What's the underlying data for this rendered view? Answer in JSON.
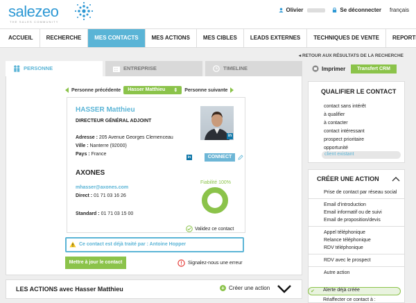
{
  "header": {
    "logo": "salezeo",
    "tagline": "THE SALES COMMUNITY",
    "user_name": "Olivier",
    "logout": "Se déconnecter",
    "language": "français"
  },
  "nav": {
    "items": [
      "ACCUEIL",
      "RECHERCHE",
      "MES CONTACTS",
      "MES ACTIONS",
      "MES CIBLES",
      "LEADS EXTERNES",
      "TECHNIQUES DE VENTE",
      "REPORTING"
    ],
    "active": "MES CONTACTS"
  },
  "back_link": "RETOUR AUX RÉSULTATS DE LA RECHERCHE",
  "tabs": [
    "PERSONNE",
    "ENTREPRISE",
    "TIMELINE"
  ],
  "prev_next": {
    "prev": "Personne précédente",
    "current": "Hasser Matthieu",
    "next": "Personne suivante"
  },
  "contact": {
    "name": "HASSER Matthieu",
    "title": "DIRECTEUR GÉNÉRAL ADJOINT",
    "address_label": "Adresse :",
    "address": "205 Avenue Georges Clemenceau",
    "city_label": "Ville :",
    "city": "Nanterre (92000)",
    "country_label": "Pays :",
    "country": "France",
    "connect": "CONNECT",
    "company": "AXONES",
    "email": "mhasser@axones.com",
    "direct_label": "Direct :",
    "direct": "01 71 03 16 26",
    "standard_label": "Standard :",
    "standard": "01 71 03 15 00",
    "reliability_label": "Fiabilité 100%",
    "reliability": 1.0,
    "validate": "Validez ce contact"
  },
  "warning": "Ce contact est déjà traité par : Antoine Hopper",
  "update_button": "Mettre à jour le contact",
  "report_error": "Signalez-nous une erreur",
  "actions": {
    "title": "LES ACTIONS avec Hasser Matthieu",
    "create": "Créer une action"
  },
  "right": {
    "print": "Imprimer",
    "transfer": "Transfert CRM",
    "qualify_title": "QUALIFIER LE CONTACT",
    "qualify_options": [
      "contact sans intérêt",
      "à qualifier",
      "à contacter",
      "contact intéressant",
      "prospect prioritaire",
      "opportunité"
    ],
    "qualify_selected": "client existant",
    "create_title": "CRÉER UNE ACTION",
    "create_groups": [
      [
        "Prise de contact par réseau social"
      ],
      [
        "Email d'introduction",
        "Email informatif ou de suivi",
        "Email de proposition/devis"
      ],
      [
        "Appel téléphonique",
        "Relance téléphonique",
        "RDV téléphonique"
      ],
      [
        "RDV avec le prospect"
      ],
      [
        "Autre action"
      ]
    ],
    "alert_done": "Alerte déjà créée",
    "reassign": "Réaffecter ce contact à :"
  },
  "colors": {
    "accent": "#5ab4d6",
    "green": "#8bc34a",
    "linkedin": "#0e76a8"
  }
}
